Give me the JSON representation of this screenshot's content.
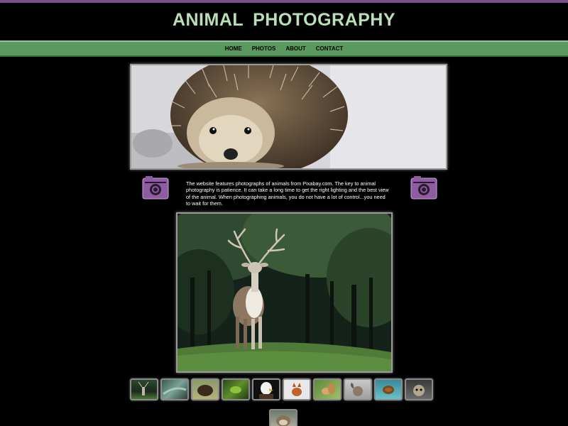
{
  "header": {
    "title": "ANIMAL  PHOTOGRAPHY"
  },
  "nav": {
    "items": [
      "HOME",
      "PHOTOS",
      "ABOUT",
      "CONTACT"
    ]
  },
  "intro": {
    "text": "The website features photographs of animals from Pixabay.com. The key to animal photography is patience. It can take a long time to get the right lighting and the best view of the animal. When photographing animals, you do not have a lot of control...you need to wait for them."
  },
  "gallery": {
    "hero_subject": "hedgehog",
    "featured_subject": "deer",
    "thumbnails": [
      "deer",
      "lizard",
      "bison",
      "frog",
      "eagle",
      "fox",
      "squirrel",
      "ram",
      "turtle",
      "monkey",
      "otter"
    ]
  },
  "colors": {
    "accent_purple": "#7c4f8b",
    "nav_green": "#5a9a5e",
    "title_green": "#b9dfb7",
    "background": "#000000"
  },
  "icons": {
    "camera": "camera-icon"
  }
}
